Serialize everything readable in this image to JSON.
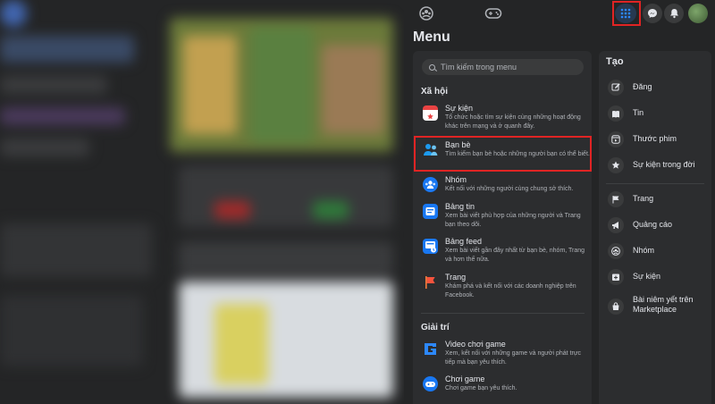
{
  "colors": {
    "accent_red": "#e02424",
    "accent_blue": "#2d88ff",
    "panel": "#242526",
    "card": "#2c2d2f"
  },
  "topbar": {
    "icons": [
      "groups-icon",
      "gaming-icon"
    ],
    "menu_icon": "grid-menu-icon",
    "messenger_icon": "messenger-icon",
    "notifications_icon": "bell-icon"
  },
  "menu": {
    "title": "Menu",
    "search_placeholder": "Tìm kiếm trong menu",
    "social": {
      "heading": "Xã hội",
      "items": [
        {
          "title": "Sự kiện",
          "desc": "Tổ chức hoặc tìm sự kiện cùng những hoạt động khác trên mạng và ở quanh đây.",
          "icon": "calendar-icon"
        },
        {
          "title": "Bạn bè",
          "desc": "Tìm kiếm bạn bè hoặc những người bạn có thể biết.",
          "icon": "friends-icon"
        },
        {
          "title": "Nhóm",
          "desc": "Kết nối với những người cùng chung sở thích.",
          "icon": "groups-icon"
        },
        {
          "title": "Bảng tin",
          "desc": "Xem bài viết phù hợp của những người và Trang bạn theo dõi.",
          "icon": "news-feed-icon"
        },
        {
          "title": "Bảng feed",
          "desc": "Xem bài viết gần đây nhất từ bạn bè, nhóm, Trang và hơn thế nữa.",
          "icon": "feeds-icon"
        },
        {
          "title": "Trang",
          "desc": "Khám phá và kết nối với các doanh nghiệp trên Facebook.",
          "icon": "pages-flag-icon"
        }
      ]
    },
    "entertainment": {
      "heading": "Giải trí",
      "items": [
        {
          "title": "Video chơi game",
          "desc": "Xem, kết nối với những game và người phát trực tiếp mà bạn yêu thích.",
          "icon": "gaming-video-icon"
        },
        {
          "title": "Chơi game",
          "desc": "Chơi game bạn yêu thích.",
          "icon": "play-games-icon"
        }
      ]
    },
    "create": {
      "heading": "Tạo",
      "items": [
        {
          "label": "Đăng",
          "icon": "edit-icon"
        },
        {
          "label": "Tin",
          "icon": "book-icon"
        },
        {
          "label": "Thước phim",
          "icon": "reels-icon"
        },
        {
          "label": "Sự kiện trong đời",
          "icon": "star-icon"
        },
        {
          "label": "Trang",
          "icon": "flag-icon"
        },
        {
          "label": "Quảng cáo",
          "icon": "megaphone-icon"
        },
        {
          "label": "Nhóm",
          "icon": "group-icon"
        },
        {
          "label": "Sự kiện",
          "icon": "event-plus-icon"
        },
        {
          "label": "Bài niêm yết trên Marketplace",
          "icon": "marketplace-bag-icon"
        }
      ]
    }
  }
}
